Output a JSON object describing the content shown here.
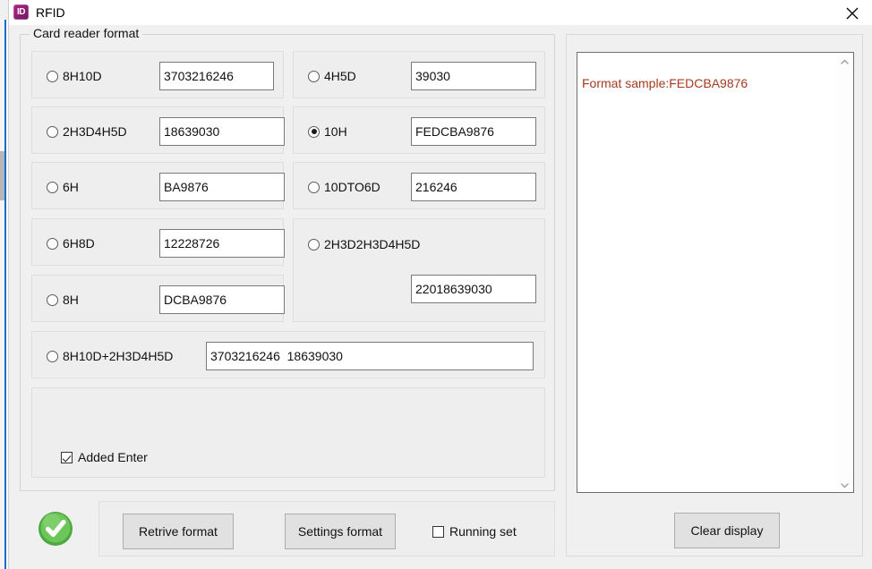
{
  "window": {
    "title": "RFID",
    "icon": "id-badge-icon",
    "close_label": "×"
  },
  "card_reader_group": {
    "legend": "Card reader format",
    "left_column": [
      {
        "id": "8h10d",
        "label": "8H10D",
        "value": "3703216246",
        "selected": false
      },
      {
        "id": "2h3d4h5d",
        "label": "2H3D4H5D",
        "value": "18639030",
        "selected": false
      },
      {
        "id": "6h",
        "label": "6H",
        "value": "BA9876",
        "selected": false
      },
      {
        "id": "6h8d",
        "label": "6H8D",
        "value": "12228726",
        "selected": false
      },
      {
        "id": "8h",
        "label": "8H",
        "value": "DCBA9876",
        "selected": false
      }
    ],
    "right_column": [
      {
        "id": "4h5d",
        "label": "4H5D",
        "value": "39030",
        "selected": false
      },
      {
        "id": "10h",
        "label": "10H",
        "value": "FEDCBA9876",
        "selected": true
      },
      {
        "id": "10dto6d",
        "label": "10DTO6D",
        "value": "216246",
        "selected": false
      }
    ],
    "stacked_option": {
      "id": "2h3d2h3d4h5d",
      "label": "2H3D2H3D4H5D",
      "value": "22018639030",
      "selected": false
    },
    "combined_option": {
      "id": "8h10d-plus-2h3d4h5d",
      "label": "8H10D+2H3D4H5D",
      "value": "3703216246  18639030",
      "selected": false
    },
    "added_enter": {
      "label": "Added Enter",
      "checked": true
    }
  },
  "actions": {
    "status_icon": "green-check-icon",
    "retrive_format_label": "Retrive format",
    "settings_format_label": "Settings format",
    "running_set": {
      "label": "Running set",
      "checked": false
    }
  },
  "display_panel": {
    "text": "Format sample:FEDCBA9876",
    "text_color": "#a63a1e",
    "clear_label": "Clear display",
    "scroll_up_icon": "chevron-up-icon",
    "scroll_down_icon": "chevron-down-icon"
  }
}
